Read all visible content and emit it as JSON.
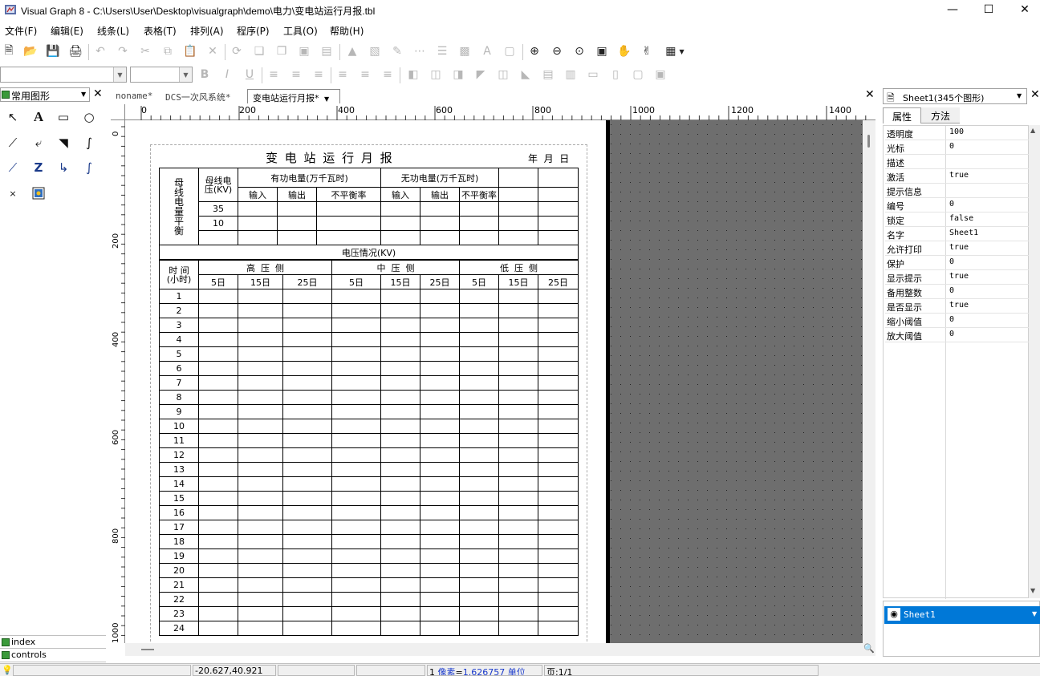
{
  "window": {
    "title": "Visual Graph 8 - C:\\Users\\User\\Desktop\\visualgraph\\demo\\电力\\变电站运行月报.tbl"
  },
  "menu": [
    "文件(F)",
    "编辑(E)",
    "线条(L)",
    "表格(T)",
    "排列(A)",
    "程序(P)",
    "工具(O)",
    "帮助(H)"
  ],
  "left_panel": {
    "dropdown": "常用图形",
    "bottom_items": [
      "index",
      "controls"
    ]
  },
  "tabs": [
    "noname*",
    "DCS一次风系统*",
    "变电站运行月报*"
  ],
  "ruler": {
    "h_labels": [
      "0",
      "200",
      "400",
      "600",
      "800",
      "1000",
      "1200",
      "1400"
    ],
    "v_labels": [
      "0",
      "200",
      "400",
      "600",
      "800",
      "1000"
    ]
  },
  "sheet": {
    "title": "变 电 站 运 行 月 报",
    "date_label": "年  月  日",
    "bus_side_label": "母线电量平衡",
    "bus_voltage_header": "母线电压(KV)",
    "active_header": "有功电量(万千瓦时)",
    "reactive_header": "无功电量(万千瓦时)",
    "sub_headers": [
      "输入",
      "输出",
      "不平衡率",
      "输入",
      "输出",
      "不平衡率"
    ],
    "bus_voltages": [
      "35",
      "10"
    ],
    "voltage_section_title": "电压情况(KV)",
    "time_header": "时 间(小时)",
    "high_side": "高  压  侧",
    "mid_side": "中  压  侧",
    "low_side": "低  压  侧",
    "day_headers": [
      "5日",
      "15日",
      "25日",
      "5日",
      "15日",
      "25日",
      "5日",
      "15日",
      "25日"
    ],
    "hours": [
      "1",
      "2",
      "3",
      "4",
      "5",
      "6",
      "7",
      "8",
      "9",
      "10",
      "11",
      "12",
      "13",
      "14",
      "15",
      "16",
      "17",
      "18",
      "19",
      "20",
      "21",
      "22",
      "23",
      "24"
    ]
  },
  "right_panel": {
    "sheet_selector": "Sheet1(345个图形)",
    "tab_properties": "属性",
    "tab_methods": "方法",
    "properties": [
      {
        "key": "透明度",
        "value": "100"
      },
      {
        "key": "光标",
        "value": "0"
      },
      {
        "key": "描述",
        "value": ""
      },
      {
        "key": "激活",
        "value": "true"
      },
      {
        "key": "提示信息",
        "value": ""
      },
      {
        "key": "编号",
        "value": "0"
      },
      {
        "key": "锁定",
        "value": "false"
      },
      {
        "key": "名字",
        "value": "Sheet1"
      },
      {
        "key": "允许打印",
        "value": "true"
      },
      {
        "key": "保护",
        "value": "0"
      },
      {
        "key": "显示提示",
        "value": "true"
      },
      {
        "key": "备用整数",
        "value": "0"
      },
      {
        "key": "是否显示",
        "value": "true"
      },
      {
        "key": "缩小阈值",
        "value": "0"
      },
      {
        "key": "放大阈值",
        "value": "0"
      }
    ],
    "layer_item": "Sheet1"
  },
  "status": {
    "coords": "-20.627,40.921",
    "scale_prefix": "1",
    "scale_unit": "像素",
    "scale_value": "1.626757",
    "scale_suffix": "单位",
    "page": "页:1/1"
  },
  "colors": {
    "selection": "#0078d7",
    "canvas_bg": "#6e6e6e"
  }
}
